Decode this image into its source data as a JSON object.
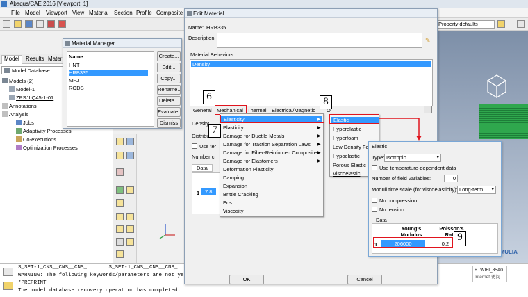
{
  "app": {
    "title": "Abaqus/CAE 2016 [Viewport: 1]",
    "menus": [
      "File",
      "Model",
      "Viewport",
      "View",
      "Material",
      "Section",
      "Profile",
      "Composite"
    ],
    "property_defaults": "Property defaults"
  },
  "left_panel": {
    "tabs": [
      "Model",
      "Results",
      "Materials"
    ],
    "dropdown": "Model Database",
    "tree": [
      {
        "label": "Models (2)",
        "depth": 0
      },
      {
        "label": "Model-1",
        "depth": 1
      },
      {
        "label": "ZPSJLQ45-1-01",
        "depth": 1
      },
      {
        "label": "Annotations",
        "depth": 0
      },
      {
        "label": "Analysis",
        "depth": 0
      },
      {
        "label": "Jobs",
        "depth": 1
      },
      {
        "label": "Adaptivity Processes",
        "depth": 1
      },
      {
        "label": "Co-executions",
        "depth": 1
      },
      {
        "label": "Optimization Processes",
        "depth": 1
      }
    ]
  },
  "material_manager": {
    "title": "Material Manager",
    "column": "Name",
    "items": [
      "HNT",
      "HRB335",
      "MFJ",
      "RODS"
    ],
    "selected": "HRB335",
    "buttons": [
      "Create...",
      "Edit...",
      "Copy...",
      "Rename...",
      "Delete...",
      "Evaluate...",
      "Dismiss"
    ]
  },
  "edit_material": {
    "title": "Edit Material",
    "name_label": "Name:",
    "name_value": "HRB335",
    "description_label": "Description:",
    "behaviors_label": "Material Behaviors",
    "behaviors": [
      "Density"
    ],
    "tabs": [
      "General",
      "Mechanical",
      "Thermal",
      "Electrical/Magnetic",
      "O"
    ],
    "density_label": "Density",
    "distribution_label": "Distributi",
    "use_temp_label": "Use ter",
    "number_label": "Number c",
    "data_label": "Data",
    "col_header": "D",
    "row_index": "1",
    "row_value": "7.8",
    "ok": "OK",
    "cancel": "Cancel"
  },
  "mechanical_menu": [
    "Elasticity",
    "Plasticity",
    "Damage for Ductile Metals",
    "Damage for Traction Separation Laws",
    "Damage for Fiber-Reinforced Composites",
    "Damage for Elastomers",
    "Deformation Plasticity",
    "Damping",
    "Expansion",
    "Brittle Cracking",
    "Eos",
    "Viscosity"
  ],
  "elasticity_menu": [
    "Elastic",
    "Hyperelastic",
    "Hyperfoam",
    "Low Density Foam",
    "Hypoelastic",
    "Porous Elastic",
    "Viscoelastic"
  ],
  "elastic_panel": {
    "title": "Elastic",
    "type_label": "Type:",
    "type_value": "Isotropic",
    "use_temp": "Use temperature-dependent data",
    "field_vars_label": "Number of field variables:",
    "field_vars_value": "0",
    "moduli_label": "Moduli time scale (for viscoelasticity):",
    "moduli_value": "Long-term",
    "no_compression": "No compression",
    "no_tension": "No tension",
    "data_label": "Data",
    "col1": "Young's Modulus",
    "col2": "Poisson's Ratio",
    "row_index": "1",
    "young": "206000",
    "poisson": "0.2"
  },
  "callouts": [
    "6",
    "7",
    "8",
    "9"
  ],
  "messages": [
    "S_SET-1_CNS__CNS__CNS_       S_SET-1_CNS__CNS__CNS_",
    "WARNING: The following keywords/parameters are not ye",
    "*PREPRINT",
    "The model database recovery operation has completed."
  ],
  "status": {
    "ssid": "BTWIFI_85A0",
    "label": "Internet 访问"
  },
  "colors": {
    "selection": "#3399ff",
    "callout_red": "#e0141e",
    "mesh_green": "#2fa74d"
  }
}
